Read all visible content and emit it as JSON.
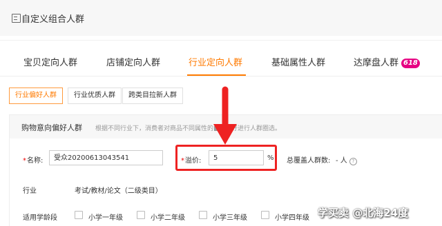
{
  "header": {
    "title": "自定义组合人群"
  },
  "tabs": [
    {
      "label": "宝贝定向人群"
    },
    {
      "label": "店铺定向人群"
    },
    {
      "label": "行业定向人群"
    },
    {
      "label": "基础属性人群"
    },
    {
      "label": "达摩盘人群",
      "badge": "618"
    }
  ],
  "active_tab": "行业定向人群",
  "subtabs": [
    {
      "label": "行业偏好人群"
    },
    {
      "label": "行业优质人群"
    },
    {
      "label": "跨类目拉新人群"
    }
  ],
  "section": {
    "title": "购物意向偏好人群",
    "description": "根据不同行业下，消费者对商品不同属性的■■偏好进行人群圈选。"
  },
  "form": {
    "name_label": "名称:",
    "name_value": "受众20200613043541",
    "premium_label": "溢价:",
    "premium_value": "5",
    "premium_unit": "%",
    "coverage_label": "总覆盖人群数:",
    "coverage_value": "- 人",
    "industry_label": "行业",
    "industry_value": "考试/教材/论文（二级类目）",
    "grade_label": "适用学龄段",
    "grade_options": [
      "小学一年级",
      "小学二年级",
      "小学三年级",
      "小学四年级"
    ]
  },
  "watermark": "学买卖 @北海24度",
  "colors": {
    "accent": "#ff7a00",
    "annotation": "#e22222",
    "badge": "#e60082"
  }
}
